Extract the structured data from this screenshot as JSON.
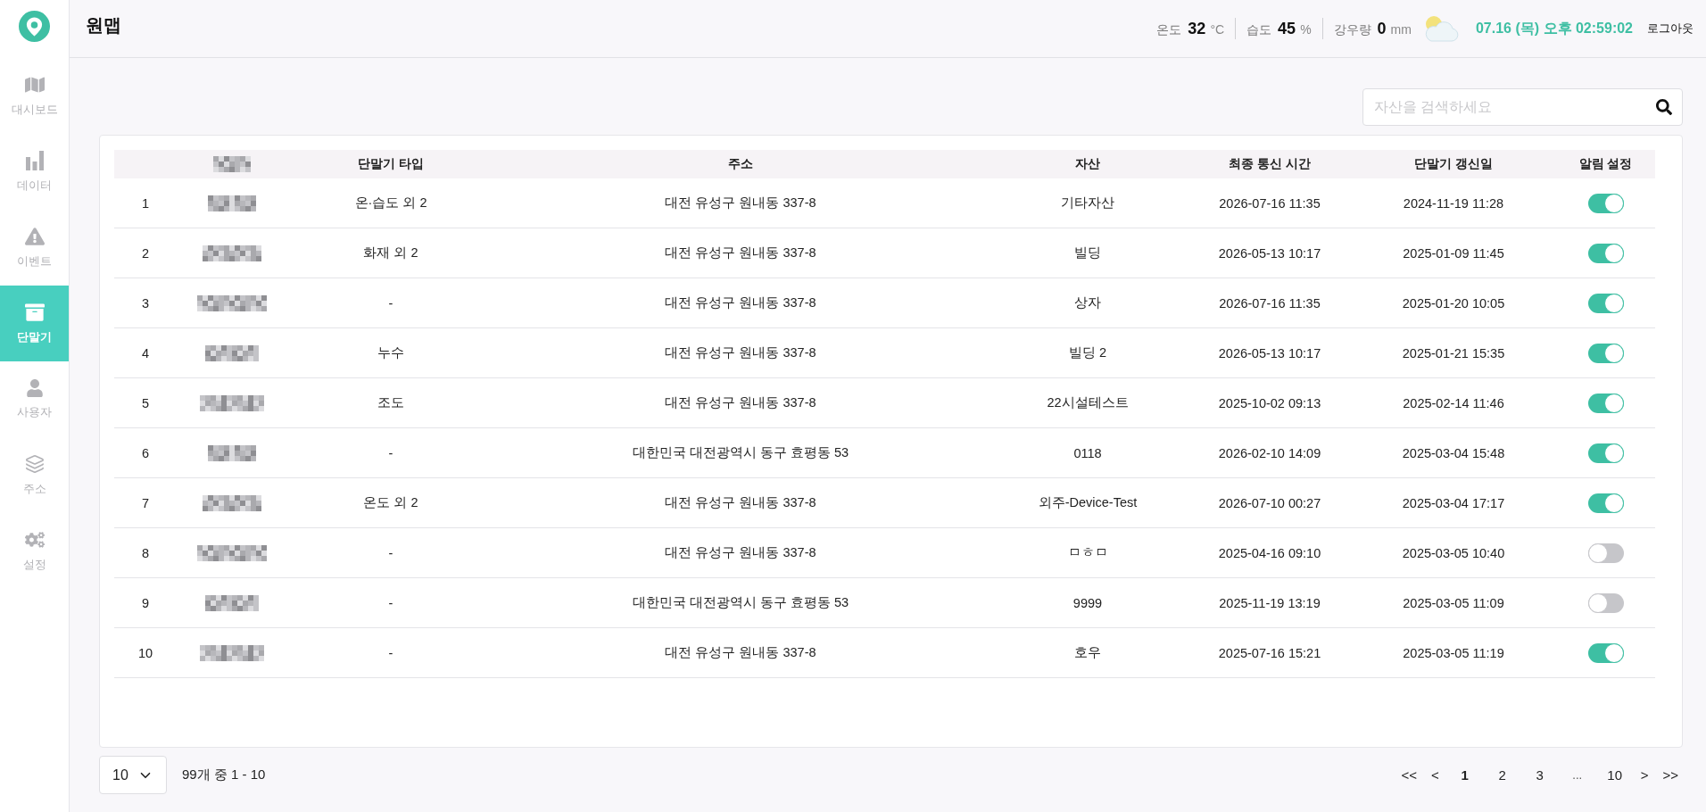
{
  "app": {
    "title": "원맵"
  },
  "sidebar": {
    "items": [
      {
        "label": "대시보드",
        "selected": false
      },
      {
        "label": "데이터",
        "selected": false
      },
      {
        "label": "이벤트",
        "selected": false
      },
      {
        "label": "단말기",
        "selected": true
      },
      {
        "label": "사용자",
        "selected": false
      },
      {
        "label": "주소",
        "selected": false
      },
      {
        "label": "설정",
        "selected": false
      }
    ]
  },
  "header": {
    "weather": [
      {
        "label": "온도",
        "value": "32",
        "unit": "°C"
      },
      {
        "label": "습도",
        "value": "45",
        "unit": "%"
      },
      {
        "label": "강우량",
        "value": "0",
        "unit": "mm"
      }
    ],
    "datetime": "07.16 (목) 오후 02:59:02",
    "logout": "로그아웃"
  },
  "search": {
    "placeholder": "자산을 검색하세요"
  },
  "table": {
    "columns": [
      "단말기 타입",
      "주소",
      "자산",
      "최종 통신 시간",
      "단말기 갱신일",
      "알림 설정"
    ],
    "rows": [
      {
        "no": "1",
        "type": "온·습도 외 2",
        "address": "대전 유성구 원내동 337-8",
        "asset": "기타자산",
        "last_communication": "2026-07-16 11:35",
        "device_renewed": "2024-11-19 11:28",
        "alert_on": true
      },
      {
        "no": "2",
        "type": "화재 외 2",
        "address": "대전 유성구 원내동 337-8",
        "asset": "빌딩",
        "last_communication": "2026-05-13 10:17",
        "device_renewed": "2025-01-09 11:45",
        "alert_on": true
      },
      {
        "no": "3",
        "type": "-",
        "address": "대전 유성구 원내동 337-8",
        "asset": "상자",
        "last_communication": "2026-07-16 11:35",
        "device_renewed": "2025-01-20 10:05",
        "alert_on": true
      },
      {
        "no": "4",
        "type": "누수",
        "address": "대전 유성구 원내동 337-8",
        "asset": "빌딩 2",
        "last_communication": "2026-05-13 10:17",
        "device_renewed": "2025-01-21 15:35",
        "alert_on": true
      },
      {
        "no": "5",
        "type": "조도",
        "address": "대전 유성구 원내동 337-8",
        "asset": "22시설테스트",
        "last_communication": "2025-10-02 09:13",
        "device_renewed": "2025-02-14 11:46",
        "alert_on": true
      },
      {
        "no": "6",
        "type": "-",
        "address": "대한민국 대전광역시 동구 효평동 53",
        "asset": "0118",
        "last_communication": "2026-02-10 14:09",
        "device_renewed": "2025-03-04 15:48",
        "alert_on": true
      },
      {
        "no": "7",
        "type": "온도 외 2",
        "address": "대전 유성구 원내동 337-8",
        "asset": "외주-Device-Test",
        "last_communication": "2026-07-10 00:27",
        "device_renewed": "2025-03-04 17:17",
        "alert_on": true
      },
      {
        "no": "8",
        "type": "-",
        "address": "대전 유성구 원내동 337-8",
        "asset": "ㅁㅎㅁ",
        "last_communication": "2025-04-16 09:10",
        "device_renewed": "2025-03-05 10:40",
        "alert_on": false
      },
      {
        "no": "9",
        "type": "-",
        "address": "대한민국 대전광역시 동구 효평동 53",
        "asset": "9999",
        "last_communication": "2025-11-19 13:19",
        "device_renewed": "2025-03-05 11:09",
        "alert_on": false
      },
      {
        "no": "10",
        "type": "-",
        "address": "대전 유성구 원내동 337-8",
        "asset": "호우",
        "last_communication": "2025-07-16 15:21",
        "device_renewed": "2025-03-05 11:19",
        "alert_on": true
      }
    ]
  },
  "pagination": {
    "page_size": "10",
    "summary": "99개 중 1 - 10",
    "first": "<<",
    "previous": "<",
    "pages": [
      {
        "kind": "page",
        "label": "1",
        "selected": true
      },
      {
        "kind": "page",
        "label": "2",
        "selected": false
      },
      {
        "kind": "page",
        "label": "3",
        "selected": false
      },
      {
        "kind": "ellipsis",
        "label": "...",
        "selected": false
      },
      {
        "kind": "page",
        "label": "10",
        "selected": false
      }
    ],
    "next": ">",
    "last": ">>"
  }
}
